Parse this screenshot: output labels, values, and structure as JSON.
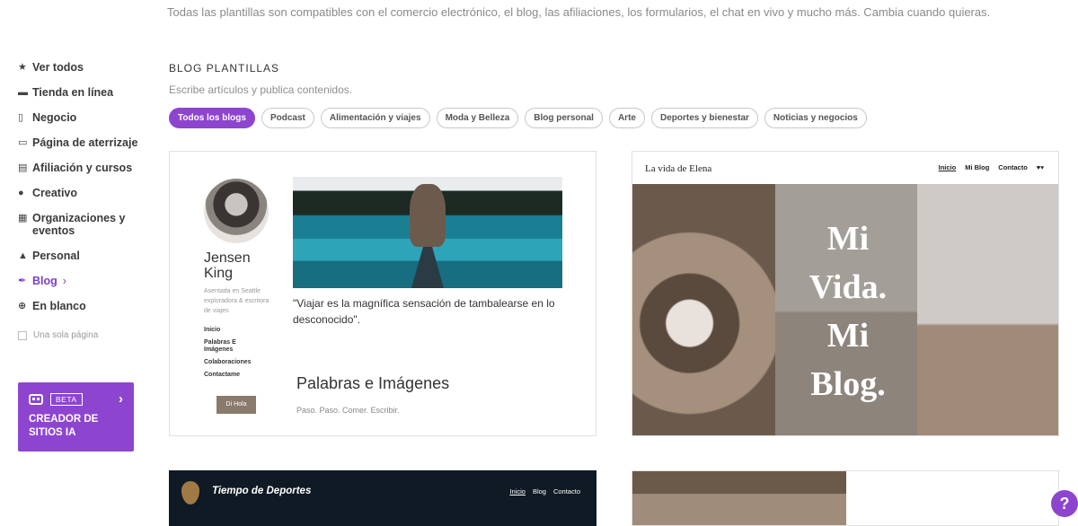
{
  "top_text": "Todas las plantillas son compatibles con el comercio electrónico, el blog, las afiliaciones, los formularios, el chat en vivo y mucho más. Cambia cuando quieras.",
  "sidebar": {
    "items": [
      {
        "label": "Ver todos",
        "icon": "star-icon",
        "glyph": "★"
      },
      {
        "label": "Tienda en línea",
        "icon": "cart-icon",
        "glyph": "🛒"
      },
      {
        "label": "Negocio",
        "icon": "clipboard-icon",
        "glyph": "▯"
      },
      {
        "label": "Página de aterrizaje",
        "icon": "window-icon",
        "glyph": "▭"
      },
      {
        "label": "Afiliación y cursos",
        "icon": "id-card-icon",
        "glyph": "▤"
      },
      {
        "label": "Creativo",
        "icon": "palette-icon",
        "glyph": "●"
      },
      {
        "label": "Organizaciones y eventos",
        "icon": "calendar-icon",
        "glyph": "▦"
      },
      {
        "label": "Personal",
        "icon": "user-icon",
        "glyph": "▲"
      },
      {
        "label": "Blog",
        "icon": "feather-icon",
        "glyph": "✒"
      },
      {
        "label": "En blanco",
        "icon": "plus-circle-icon",
        "glyph": "⊕"
      }
    ],
    "one_page": "Una sola página",
    "ai": {
      "beta": "BETA",
      "title": "CREADOR DE SITIOS IA"
    }
  },
  "section": {
    "title": "BLOG PLANTILLAS",
    "subtitle": "Escribe artículos y publica contenidos.",
    "filters": [
      "Todos los blogs",
      "Podcast",
      "Alimentación y viajes",
      "Moda y Belleza",
      "Blog personal",
      "Arte",
      "Deportes y bienestar",
      "Noticias y negocios"
    ]
  },
  "card1": {
    "name": "Jensen King",
    "bio": "Asentada en Seattle exploradora & escritora de viajes",
    "nav": [
      "Inicio",
      "Palabras E Imágenes",
      "Colaboraciones",
      "Contactame"
    ],
    "button": "Di Hola",
    "quote": "\"Viajar es la magnífica sensación de tambalearse en lo desconocido\".",
    "heading": "Palabras e Imágenes",
    "tagline": "Paso. Paso. Comer. Escribir."
  },
  "card2": {
    "brand": "La vida de Elena",
    "nav": [
      "Inicio",
      "Mi Blog",
      "Contacto"
    ],
    "social": "♥▾",
    "hero": "Mi Vida. Mi Blog."
  },
  "card3": {
    "title": "Tiempo de Deportes",
    "nav": [
      "Inicio",
      "Blog",
      "Contacto"
    ]
  },
  "help": "?"
}
